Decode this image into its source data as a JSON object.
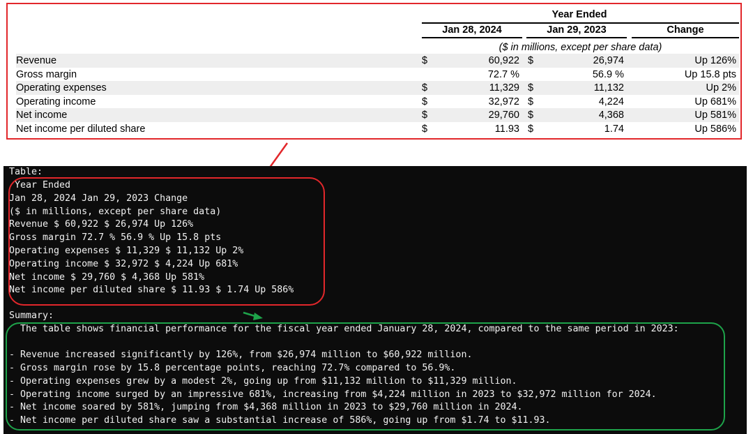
{
  "financial_table": {
    "group_header": "Year Ended",
    "columns": [
      "Jan 28, 2024",
      "Jan 29, 2023",
      "Change"
    ],
    "unit_note": "($ in millions, except per share data)",
    "rows": [
      {
        "label": "Revenue",
        "cur1": "$",
        "v1": "60,922",
        "cur2": "$",
        "v2": "26,974",
        "change": "Up 126%"
      },
      {
        "label": "Gross margin",
        "cur1": "",
        "v1": "72.7 %",
        "cur2": "",
        "v2": "56.9 %",
        "change": "Up 15.8 pts"
      },
      {
        "label": "Operating expenses",
        "cur1": "$",
        "v1": "11,329",
        "cur2": "$",
        "v2": "11,132",
        "change": "Up 2%"
      },
      {
        "label": "Operating income",
        "cur1": "$",
        "v1": "32,972",
        "cur2": "$",
        "v2": "4,224",
        "change": "Up 681%"
      },
      {
        "label": "Net income",
        "cur1": "$",
        "v1": "29,760",
        "cur2": "$",
        "v2": "4,368",
        "change": "Up 581%"
      },
      {
        "label": "Net income per diluted share",
        "cur1": "$",
        "v1": "11.93",
        "cur2": "$",
        "v2": "1.74",
        "change": "Up 586%"
      }
    ]
  },
  "terminal": {
    "table_heading": "Table:",
    "table_lines": [
      " Year Ended",
      "Jan 28, 2024 Jan 29, 2023 Change",
      "($ in millions, except per share data)",
      "Revenue $ 60,922 $ 26,974 Up 126%",
      "Gross margin 72.7 % 56.9 % Up 15.8 pts",
      "Operating expenses $ 11,329 $ 11,132 Up 2%",
      "Operating income $ 32,972 $ 4,224 Up 681%",
      "Net income $ 29,760 $ 4,368 Up 581%",
      "Net income per diluted share $ 11.93 $ 1.74 Up 586%"
    ],
    "summary_heading": "Summary:",
    "summary_lines": [
      "  The table shows financial performance for the fiscal year ended January 28, 2024, compared to the same period in 2023:",
      "",
      "- Revenue increased significantly by 126%, from $26,974 million to $60,922 million.",
      "- Gross margin rose by 15.8 percentage points, reaching 72.7% compared to 56.9%.",
      "- Operating expenses grew by a modest 2%, going up from $11,132 million to $11,329 million.",
      "- Operating income surged by an impressive 681%, increasing from $4,224 million in 2023 to $32,972 million for 2024.",
      "- Net income soared by 581%, jumping from $4,368 million in 2023 to $29,760 million in 2024.",
      "- Net income per diluted share saw a substantial increase of 586%, going up from $1.74 to $11.93."
    ]
  },
  "colors": {
    "highlight_red": "#e2272b",
    "highlight_green": "#1ea34a",
    "terminal_bg": "#0c0c0c",
    "terminal_text": "#f2f2f2",
    "row_band": "#eeeeee"
  }
}
